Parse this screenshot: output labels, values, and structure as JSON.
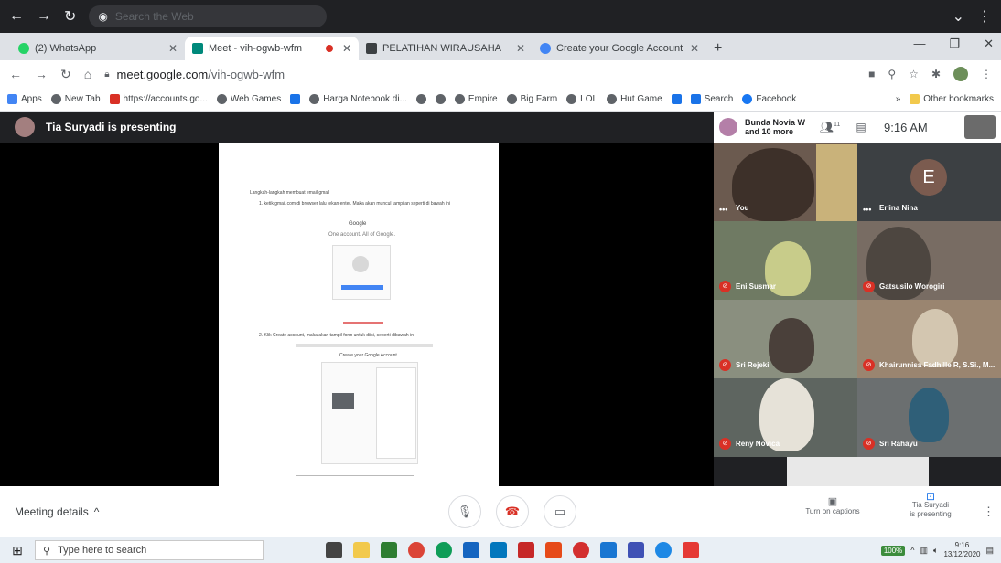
{
  "outer_bar": {
    "search_placeholder": "Search the Web",
    "icons": [
      "back-icon",
      "forward-icon",
      "reload-icon",
      "browser-logo-icon",
      "chevron-down-icon",
      "more-icon"
    ]
  },
  "tabs": [
    {
      "label": "(2) WhatsApp",
      "favicon_color": "#25d366",
      "active": false
    },
    {
      "label": "Meet - vih-ogwb-wfm",
      "favicon_color": "#00897b",
      "active": true
    },
    {
      "label": "PELATIHAN WIRAUSAHA",
      "favicon_color": "#3c4043",
      "active": false
    },
    {
      "label": "Create your Google Account",
      "favicon_color": "#4285f4",
      "active": false
    }
  ],
  "address": {
    "url_host": "meet.google.com",
    "url_path": "/vih-ogwb-wfm"
  },
  "bookmarks": [
    {
      "label": "Apps",
      "color": "#4285f4"
    },
    {
      "label": "New Tab",
      "color": "#5f6368"
    },
    {
      "label": "https://accounts.go...",
      "color": "#d93025"
    },
    {
      "label": "Web Games",
      "color": "#5f6368"
    },
    {
      "label": "",
      "color": "#1a73e8"
    },
    {
      "label": "Harga Notebook di...",
      "color": "#5f6368"
    },
    {
      "label": "",
      "color": "#5f6368"
    },
    {
      "label": "",
      "color": "#5f6368"
    },
    {
      "label": "Empire",
      "color": "#5f6368"
    },
    {
      "label": "Big Farm",
      "color": "#5f6368"
    },
    {
      "label": "LOL",
      "color": "#5f6368"
    },
    {
      "label": "Hut Game",
      "color": "#5f6368"
    },
    {
      "label": "",
      "color": "#1a73e8"
    },
    {
      "label": "Search",
      "color": "#1a73e8"
    },
    {
      "label": "Facebook",
      "color": "#1877f2"
    }
  ],
  "bookmarks_more": "»",
  "other_bookmarks": "Other bookmarks",
  "meet": {
    "presenting_label": "Tia Suryadi is presenting",
    "participants_head": {
      "name": "Bunda Novia W and 10 more",
      "count": "11",
      "time": "9:16 AM"
    },
    "tiles": [
      {
        "name": "You",
        "muted": false,
        "bg": "#6b5a4f"
      },
      {
        "name": "Erlina Nina",
        "muted": false,
        "bg": "#3c4043",
        "initial": "E"
      },
      {
        "name": "Eni Susmar",
        "muted": true,
        "bg": "#6f7a63"
      },
      {
        "name": "Gatsusilo Worogiri",
        "muted": true,
        "bg": "#786c63"
      },
      {
        "name": "Sri Rejeki",
        "muted": true,
        "bg": "#8a8f7f"
      },
      {
        "name": "Khairunnisa Fadhille R, S.Si., M...",
        "muted": true,
        "bg": "#9a8570"
      },
      {
        "name": "Reny Novica",
        "muted": true,
        "bg": "#5e6560"
      },
      {
        "name": "Sri Rahayu",
        "muted": true,
        "bg": "#6b6f70"
      }
    ],
    "meeting_details": "Meeting details",
    "turn_on_captions": "Turn on captions",
    "presenter_status_name": "Tia Suryadi",
    "presenter_status_text": "is presenting"
  },
  "document": {
    "heading": "Langkah-langkah membuat email gmail",
    "step1": "1. ketik gmail.com di browser lalu tekan enter. Maka akan muncul tampilan seperti di bawah ini",
    "google": "Google",
    "tagline": "One account. All of Google.",
    "step2": "2. Klik Create account, maka akan tampil form untuk diisi, seperti dibawah ini",
    "form_title": "Create your Google Account"
  },
  "taskbar": {
    "search_placeholder": "Type here to search",
    "battery": "100%",
    "time": "9:16",
    "date": "13/12/2020"
  }
}
